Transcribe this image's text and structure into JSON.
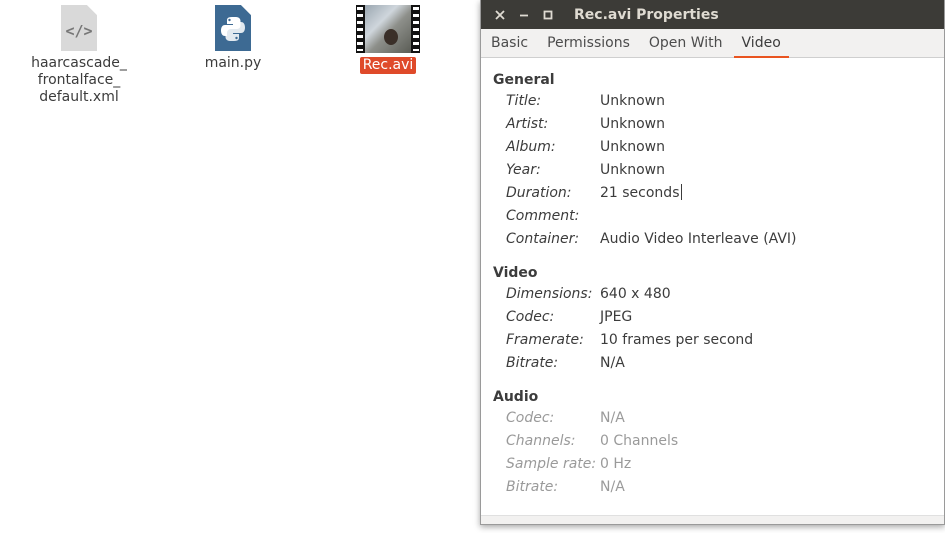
{
  "desktop": {
    "files": [
      {
        "name": "haarcascade_\nfrontalface_\ndefault.xml",
        "lines": [
          "haarcascade_",
          "frontalface_",
          "default.xml"
        ],
        "icon": "xml-file-icon"
      },
      {
        "name": "main.py",
        "icon": "python-file-icon"
      },
      {
        "name": "Rec.avi",
        "icon": "video-thumbnail",
        "selected": true
      }
    ]
  },
  "dialog": {
    "title": "Rec.avi Properties",
    "window_buttons": {
      "close": "×",
      "minimize": "−",
      "maximize": "□"
    },
    "tabs": [
      "Basic",
      "Permissions",
      "Open With",
      "Video"
    ],
    "active_tab": "Video",
    "accent_color": "#e95420",
    "sections": {
      "general": {
        "title": "General",
        "rows": [
          {
            "label": "Title:",
            "value": "Unknown"
          },
          {
            "label": "Artist:",
            "value": "Unknown"
          },
          {
            "label": "Album:",
            "value": "Unknown"
          },
          {
            "label": "Year:",
            "value": "Unknown"
          },
          {
            "label": "Duration:",
            "value": "21 seconds"
          },
          {
            "label": "Comment:",
            "value": ""
          },
          {
            "label": "Container:",
            "value": "Audio Video Interleave (AVI)"
          }
        ]
      },
      "video": {
        "title": "Video",
        "rows": [
          {
            "label": "Dimensions:",
            "value": "640 x 480"
          },
          {
            "label": "Codec:",
            "value": "JPEG"
          },
          {
            "label": "Framerate:",
            "value": "10 frames per second"
          },
          {
            "label": "Bitrate:",
            "value": "N/A"
          }
        ]
      },
      "audio": {
        "title": "Audio",
        "rows": [
          {
            "label": "Codec:",
            "value": "N/A"
          },
          {
            "label": "Channels:",
            "value": "0 Channels"
          },
          {
            "label": "Sample rate:",
            "value": "0 Hz"
          },
          {
            "label": "Bitrate:",
            "value": "N/A"
          }
        ]
      }
    }
  }
}
